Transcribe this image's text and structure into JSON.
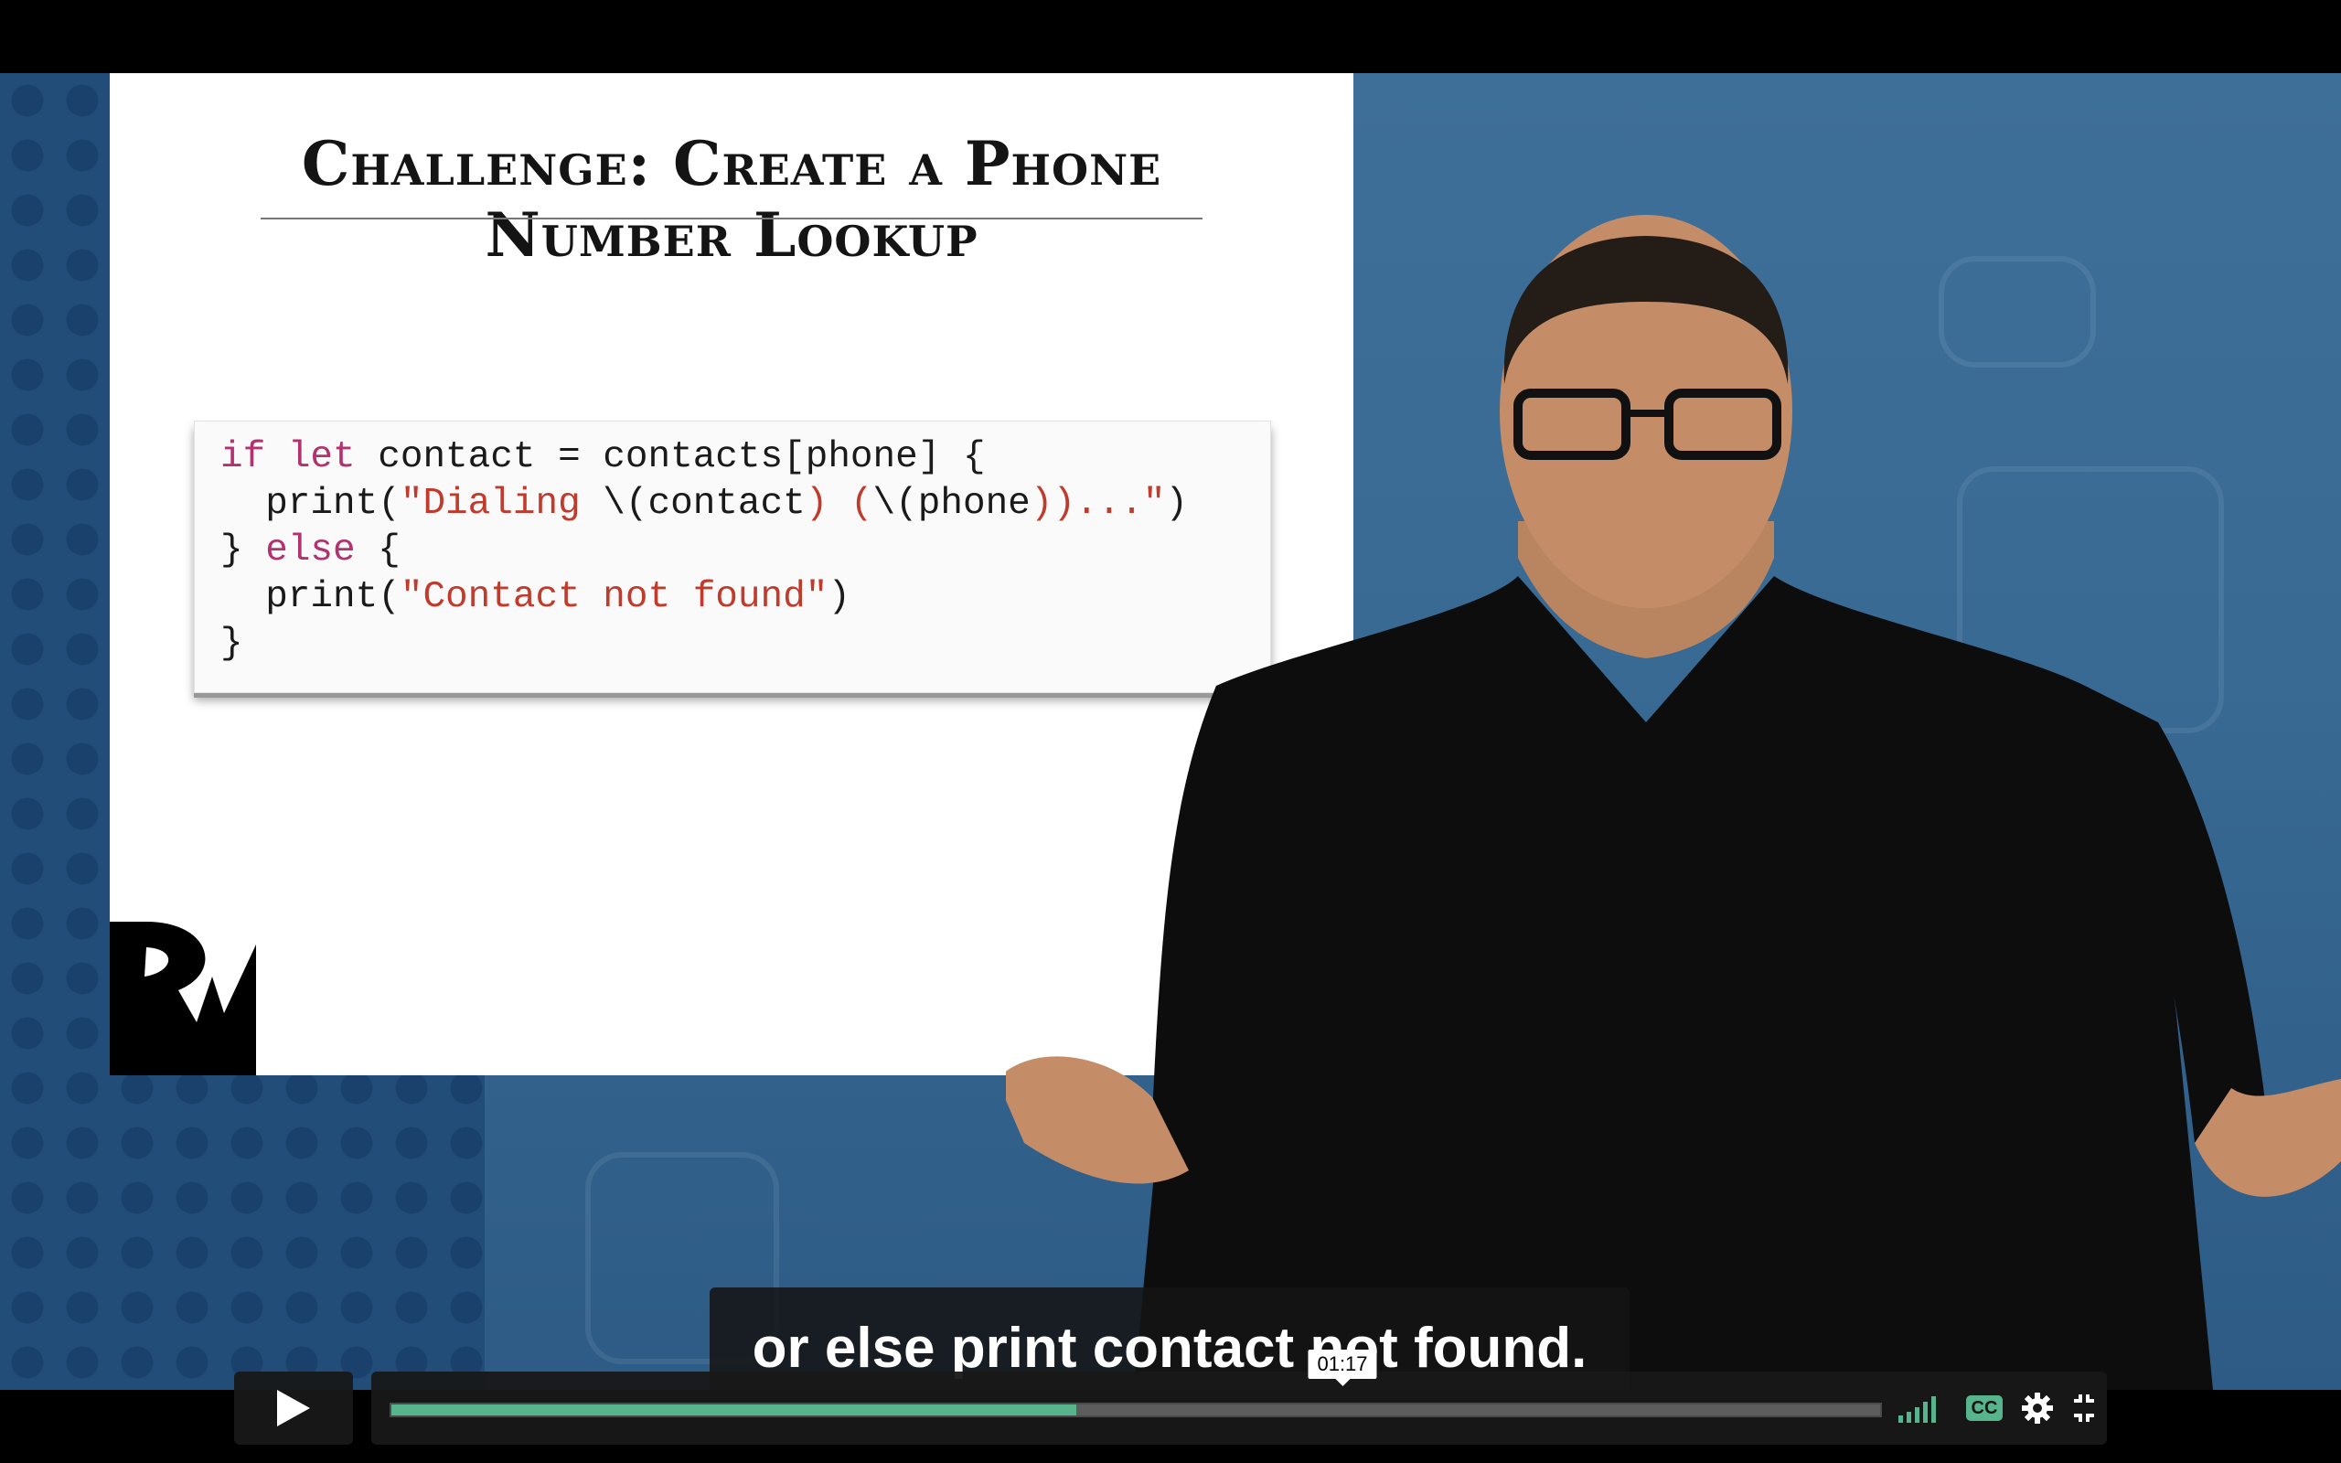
{
  "slide": {
    "title": "Challenge: Create a Phone Number Lookup",
    "code": {
      "line1": {
        "kw1": "if",
        "kw2": "let",
        "rest": " contact = contacts[phone] {"
      },
      "line2": {
        "pre": "  print(",
        "s1": "\"Dialing ",
        "mid1": "\\(",
        "s2": "contact",
        "s3": ") (",
        "mid2": "\\(",
        "s4": "phone",
        "s5": "))...\"",
        "post": ")"
      },
      "line3": {
        "pre": "} ",
        "kw": "else",
        "post": " {"
      },
      "line4": {
        "pre": "  print(",
        "s": "\"Contact not found\"",
        "post": ")"
      },
      "line5": "}"
    }
  },
  "caption": {
    "text": "or else print contact not found."
  },
  "player": {
    "current_time": "01:17",
    "progress_fraction": 0.46,
    "cc_label": "CC",
    "colors": {
      "accent": "#57b58e",
      "panel": "#181818"
    }
  },
  "icons": {
    "play": "play-icon",
    "volume": "volume-icon",
    "cc": "closed-captions-icon",
    "settings": "gear-icon",
    "fullscreen": "exit-fullscreen-icon"
  }
}
